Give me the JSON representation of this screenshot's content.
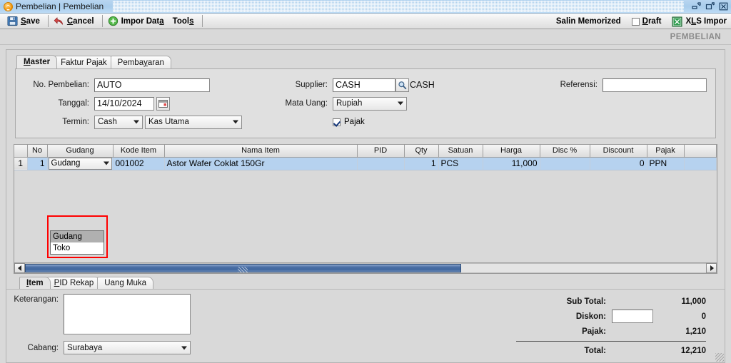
{
  "window": {
    "title": "Pembelian | Pembelian",
    "app_icon": "app-icon",
    "controls": {
      "restore": "restore-icon",
      "maximize": "maximize-icon",
      "close": "close-icon"
    }
  },
  "toolbar": {
    "save_label": "Save",
    "cancel_label": "Cancel",
    "import_label": "Impor Data",
    "tools_label": "Tools",
    "salin_memorized_label": "Salin Memorized",
    "draft_label": "Draft",
    "draft_checked": false,
    "xls_label": "XLS Impor"
  },
  "module_label": "PEMBELIAN",
  "tabs": [
    {
      "label": "Master",
      "active": true
    },
    {
      "label": "Faktur Pajak",
      "active": false
    },
    {
      "label": "Pembayaran",
      "active": false
    }
  ],
  "form": {
    "no_pembelian_label": "No. Pembelian:",
    "no_pembelian_value": "AUTO",
    "tanggal_label": "Tanggal:",
    "tanggal_value": "14/10/2024",
    "termin_label": "Termin:",
    "termin_value": "Cash",
    "termin_akun_value": "Kas Utama",
    "supplier_label": "Supplier:",
    "supplier_value": "CASH",
    "supplier_name": "CASH",
    "mata_uang_label": "Mata Uang:",
    "mata_uang_value": "Rupiah",
    "pajak_label": "Pajak",
    "pajak_checked": true,
    "referensi_label": "Referensi:",
    "referensi_value": ""
  },
  "grid": {
    "columns": [
      "No",
      "Gudang",
      "Kode Item",
      "Nama Item",
      "PID",
      "Qty",
      "Satuan",
      "Harga",
      "Disc %",
      "Discount",
      "Pajak",
      ""
    ],
    "rows": [
      {
        "row_indicator": "1",
        "no": "1",
        "gudang": "Gudang",
        "kode_item": "001002",
        "nama_item": "Astor Wafer Coklat 150Gr",
        "pid": "",
        "qty": "1",
        "satuan": "PCS",
        "harga": "11,000",
        "disc_persen": "",
        "discount": "0",
        "pajak": "PPN",
        "extra": ""
      }
    ],
    "open_dropdown": {
      "options": [
        {
          "label": "Gudang",
          "selected": true
        },
        {
          "label": "Toko",
          "selected": false
        }
      ]
    }
  },
  "bottom_tabs": [
    {
      "label": "Item",
      "active": true
    },
    {
      "label": "PID Rekap",
      "active": false
    },
    {
      "label": "Uang Muka",
      "active": false
    }
  ],
  "footer": {
    "keterangan_label": "Keterangan:",
    "keterangan_value": "",
    "cabang_label": "Cabang:",
    "cabang_value": "Surabaya",
    "totals": [
      {
        "label": "Sub Total:",
        "value": "11,000",
        "has_input": false
      },
      {
        "label": "Diskon:",
        "value": "0",
        "has_input": true,
        "input_value": ""
      },
      {
        "label": "Pajak:",
        "value": "1,210",
        "has_input": false
      },
      {
        "label": "Total:",
        "value": "12,210",
        "has_input": false
      }
    ]
  },
  "colors": {
    "titlebar": "#a9cdec",
    "row_selected": "#b6d2ef",
    "annotation": "#ff0000",
    "scrollbar_thumb": "#41679e",
    "module_text": "#8a8a8a"
  }
}
